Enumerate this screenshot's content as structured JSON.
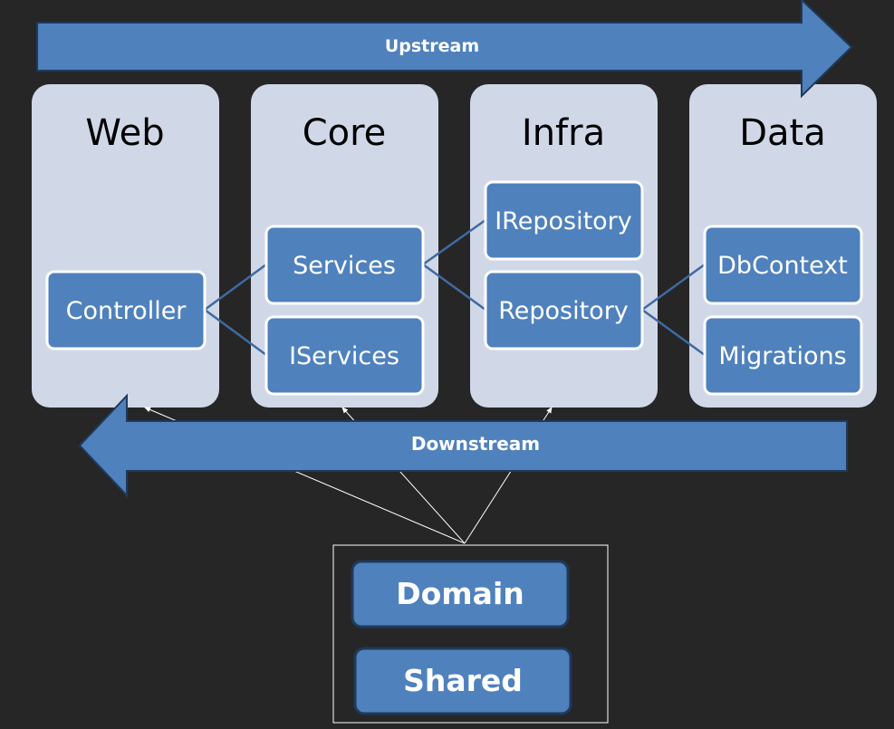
{
  "colors": {
    "background": "#262626",
    "arrow_fill": "#4f81bd",
    "column_fill": "#d0d8e8",
    "box_fill": "#4f81bd",
    "connector": "#3f6aa0"
  },
  "arrows": {
    "upstream": "Upstream",
    "downstream": "Downstream"
  },
  "columns": [
    {
      "title": "Web",
      "boxes": [
        "Controller"
      ]
    },
    {
      "title": "Core",
      "boxes": [
        "Services",
        "IServices"
      ]
    },
    {
      "title": "Infra",
      "boxes": [
        "IRepository",
        "Repository"
      ]
    },
    {
      "title": "Data",
      "boxes": [
        "DbContext",
        "Migrations"
      ]
    }
  ],
  "shared_group": {
    "boxes": [
      "Domain",
      "Shared"
    ]
  }
}
